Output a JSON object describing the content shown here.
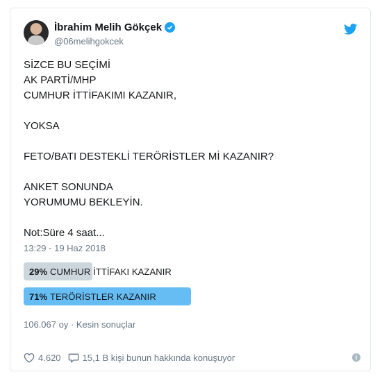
{
  "author": {
    "display_name": "İbrahim Melih Gökçek",
    "handle": "@06melihgokcek",
    "verified": true
  },
  "tweet": {
    "lines": [
      "SİZCE BU SEÇİMİ",
      "AK PARTİ/MHP",
      "CUMHUR İTTİFAKIMI KAZANIR,",
      "",
      "YOKSA",
      "",
      "FETO/BATI DESTEKLİ TERÖRİSTLER Mİ KAZANIR?",
      "",
      "ANKET SONUNDA",
      "YORUMUMU BEKLEYİN.",
      "",
      "Not:Süre 4 saat..."
    ],
    "timestamp": "13:29 - 19 Haz 2018"
  },
  "poll": {
    "options": [
      {
        "percent_label": "29%",
        "percent": 29,
        "label": "CUMHUR İTTİFAKI KAZANIR",
        "winner": false
      },
      {
        "percent_label": "71%",
        "percent": 71,
        "label": "TERÖRİSTLER KAZANIR",
        "winner": true
      }
    ],
    "stats": "106.067 oy · Kesin sonuçlar"
  },
  "actions": {
    "likes": "4.620",
    "talking": "15,1 B kişi bunun hakkında konuşuyor"
  },
  "icons": [
    "verified-badge-icon",
    "twitter-bird-icon",
    "heart-icon",
    "comment-icon",
    "info-icon"
  ],
  "colors": {
    "accent": "#1da1f2",
    "poll_winner": "#66bdf3",
    "poll_other": "#ccd6dd",
    "muted": "#657786"
  }
}
